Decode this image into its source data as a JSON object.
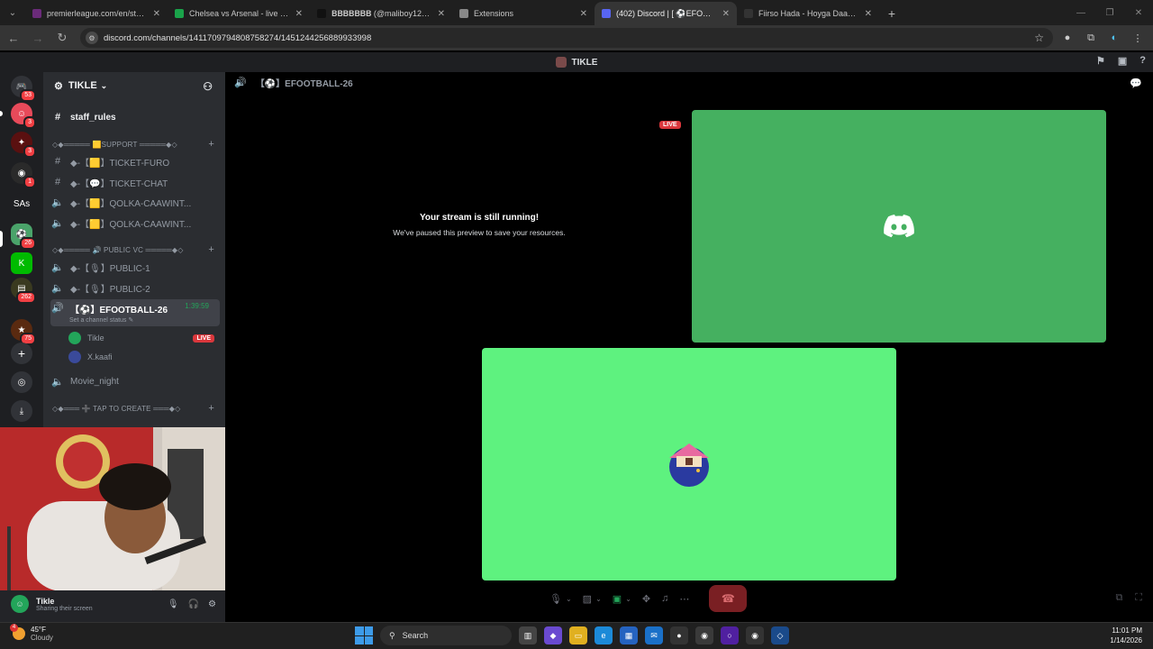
{
  "browser": {
    "tabs": [
      {
        "label": "premierleague.com/en/stats/cl",
        "color": "#6b2b7a",
        "active": false
      },
      {
        "label": "Chelsea vs Arsenal - live score,",
        "color": "#1aa34a",
        "active": false
      },
      {
        "label": "𝐁𝐁𝐁𝐁𝐁𝐁𝐁 (@maliboy12) is",
        "color": "#111111",
        "active": false
      },
      {
        "label": "Extensions",
        "color": "#888888",
        "active": false
      },
      {
        "label": "(402) Discord | [ ⚽EFOOTB",
        "color": "#5865f2",
        "active": true
      },
      {
        "label": "Fiirso Hada - Hoyga Daawasha",
        "color": "#333333",
        "active": false
      }
    ],
    "url": "discord.com/channels/1411709794808758274/1451244256889933998"
  },
  "discord": {
    "title": "TIKLE",
    "guild_name": "TIKLE",
    "server_badges": [
      "53",
      "3",
      "3",
      "1",
      "26",
      "262",
      "75"
    ],
    "server_text_icon": "SAs",
    "channels": {
      "staff_rules": "staff_rules",
      "cat_support": "◇◆═════ 🟨SUPPORT ═════◆◇",
      "ticket_furo": "◆-【🟨】TICKET-FURO",
      "ticket_chat": "◆-【💬】TICKET-CHAT",
      "qolka1": "◆-【🟨】QOLKA-CAAWINT...",
      "qolka2": "◆-【🟨】QOLKA-CAAWINT...",
      "cat_public": "◇◆═════ 🔊 PUBLIC VC ═════◆◇",
      "public1": "◆-【🎙】PUBLIC-1",
      "public2": "◆-【🎙】PUBLIC-2",
      "efootball": "【⚽】EFOOTBALL-26",
      "efootball_timer": "1:39:59",
      "set_status": "Set a channel status ✎",
      "movie_night": "Movie_night",
      "cat_tap": "◇◆═══ ➕ TAP TO CREATE ═══◆◇"
    },
    "members": [
      {
        "name": "Tikle",
        "live": "LIVE",
        "color": "#23a55a"
      },
      {
        "name": "X.kaafi",
        "live": "",
        "color": "#3a4a9a"
      }
    ],
    "user_panel": {
      "name": "Tikle",
      "status": "Sharing their screen"
    },
    "voice_header": "【⚽】EFOOTBALL-26",
    "stream_notice": {
      "title": "Your stream is still running!",
      "subtitle": "We've paused this preview to save your resources."
    },
    "live_label": "LIVE",
    "colors": {
      "tile1": "#45b060",
      "tile2": "#5ef27f",
      "live": "#da373c"
    }
  },
  "taskbar": {
    "weather_temp": "45°F",
    "weather_desc": "Cloudy",
    "weather_alert": "4",
    "search_placeholder": "Search",
    "time": "11:01 PM",
    "date": "1/14/2026"
  }
}
